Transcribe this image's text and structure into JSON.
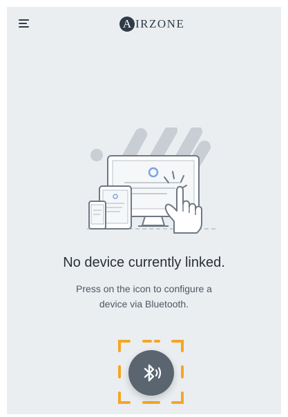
{
  "header": {
    "menu_icon": "hamburger-menu-icon",
    "logo_mark": "A",
    "logo_text": "IRZONE"
  },
  "empty_state": {
    "illustration": "devices-touch-illustration",
    "title": "No device currently linked.",
    "description": "Press on the icon to configure a device via Bluetooth."
  },
  "bluetooth": {
    "icon": "bluetooth-icon",
    "accent_color": "#f5a623"
  },
  "colors": {
    "background": "#eaeef1",
    "text": "#2a2f35",
    "button": "#5a6570"
  }
}
